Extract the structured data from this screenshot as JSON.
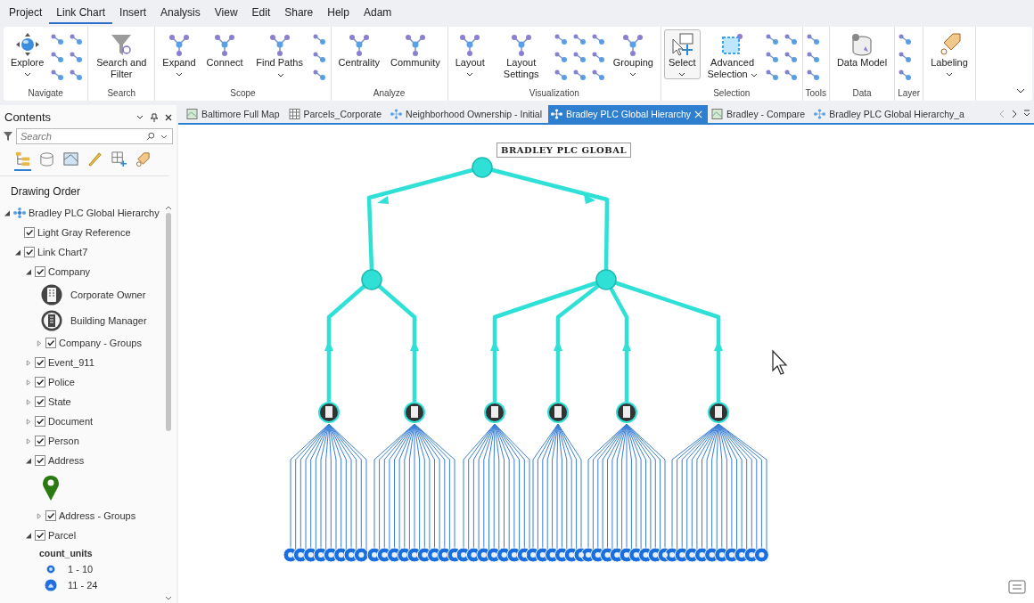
{
  "menu": [
    {
      "label": "Project",
      "selected": false
    },
    {
      "label": "Link Chart",
      "selected": true
    },
    {
      "label": "Insert",
      "selected": false
    },
    {
      "label": "Analysis",
      "selected": false
    },
    {
      "label": "View",
      "selected": false
    },
    {
      "label": "Edit",
      "selected": false
    },
    {
      "label": "Share",
      "selected": false
    },
    {
      "label": "Help",
      "selected": false
    },
    {
      "label": "Adam",
      "selected": false
    }
  ],
  "ribbon": {
    "groups": [
      {
        "label": "Navigate",
        "buttons": [
          {
            "label": "Explore",
            "kind": "split",
            "selected": false
          }
        ]
      },
      {
        "label": "Search",
        "buttons": [
          {
            "label": "Search and Filter",
            "kind": "plain",
            "selected": false
          }
        ]
      },
      {
        "label": "Scope",
        "buttons": [
          {
            "label": "Expand",
            "kind": "split",
            "selected": false
          },
          {
            "label": "Connect",
            "kind": "plain",
            "selected": false
          },
          {
            "label": "Find Paths",
            "kind": "menu",
            "selected": false
          }
        ]
      },
      {
        "label": "Analyze",
        "buttons": [
          {
            "label": "Centrality",
            "kind": "plain",
            "selected": false
          },
          {
            "label": "Community",
            "kind": "plain",
            "selected": false
          }
        ]
      },
      {
        "label": "Visualization",
        "buttons": [
          {
            "label": "Layout",
            "kind": "split",
            "selected": false
          },
          {
            "label": "Layout Settings",
            "kind": "plain",
            "selected": false
          },
          {
            "label": "Grouping",
            "kind": "split",
            "selected": false
          }
        ]
      },
      {
        "label": "Selection",
        "buttons": [
          {
            "label": "Select",
            "kind": "split",
            "selected": true
          },
          {
            "label": "Advanced Selection",
            "kind": "menu",
            "selected": false
          }
        ]
      },
      {
        "label": "Tools"
      },
      {
        "label": "Data",
        "buttons": [
          {
            "label": "Data Model",
            "kind": "plain",
            "selected": false
          }
        ]
      },
      {
        "label": "Layer"
      },
      {
        "buttons": [
          {
            "label": "Labeling",
            "kind": "split",
            "selected": false
          }
        ]
      }
    ]
  },
  "contents": {
    "title": "Contents",
    "search": {
      "placeholder": "Search"
    },
    "heading": "Drawing Order",
    "tree": [
      {
        "kind": "map",
        "label": "Bradley PLC Global Hierarchy",
        "expanded": true,
        "children": [
          {
            "kind": "layer",
            "label": "Light Gray Reference",
            "checked": true
          },
          {
            "kind": "layer",
            "label": "Link Chart7",
            "checked": true,
            "expanded": true,
            "children": [
              {
                "kind": "layer",
                "label": "Company",
                "checked": true,
                "expanded": true,
                "children": [
                  {
                    "kind": "owner",
                    "label": "Corporate Owner"
                  },
                  {
                    "kind": "manager",
                    "label": "Building Manager"
                  },
                  {
                    "kind": "layer",
                    "label": "Company - Groups",
                    "checked": true,
                    "expanded": false
                  }
                ]
              },
              {
                "kind": "layer",
                "label": "Event_911",
                "checked": true,
                "expanded": false
              },
              {
                "kind": "layer",
                "label": "Police",
                "checked": true,
                "expanded": false
              },
              {
                "kind": "layer",
                "label": "State",
                "checked": true,
                "expanded": false
              },
              {
                "kind": "layer",
                "label": "Document",
                "checked": true,
                "expanded": false
              },
              {
                "kind": "layer",
                "label": "Person",
                "checked": true,
                "expanded": false
              },
              {
                "kind": "layer",
                "label": "Address",
                "checked": true,
                "expanded": true,
                "children": [
                  {
                    "kind": "pin"
                  },
                  {
                    "kind": "layer",
                    "label": "Address - Groups",
                    "checked": true,
                    "expanded": false
                  }
                ]
              },
              {
                "kind": "layer",
                "label": "Parcel",
                "checked": true,
                "expanded": true,
                "children": [
                  {
                    "kind": "heading",
                    "label": "count_units"
                  },
                  {
                    "kind": "smalldot",
                    "label": "1 - 10"
                  },
                  {
                    "kind": "bigdot",
                    "label": "11 - 24"
                  }
                ]
              }
            ]
          }
        ]
      }
    ]
  },
  "tabs": [
    {
      "label": "Baltimore Full Map",
      "kind": "map",
      "selected": false
    },
    {
      "label": "Parcels_Corporate",
      "kind": "table",
      "selected": false
    },
    {
      "label": "Neighborhood Ownership - Initial",
      "kind": "chart",
      "selected": false
    },
    {
      "label": "Bradley PLC Global Hierarchy",
      "kind": "chart",
      "selected": true
    },
    {
      "label": "Bradley - Compare",
      "kind": "map",
      "selected": false
    },
    {
      "label": "Bradley PLC Global Hierarchy_a",
      "kind": "chart",
      "selected": false
    }
  ],
  "diagram": {
    "title": "BRADLEY PLC GLOBAL"
  }
}
